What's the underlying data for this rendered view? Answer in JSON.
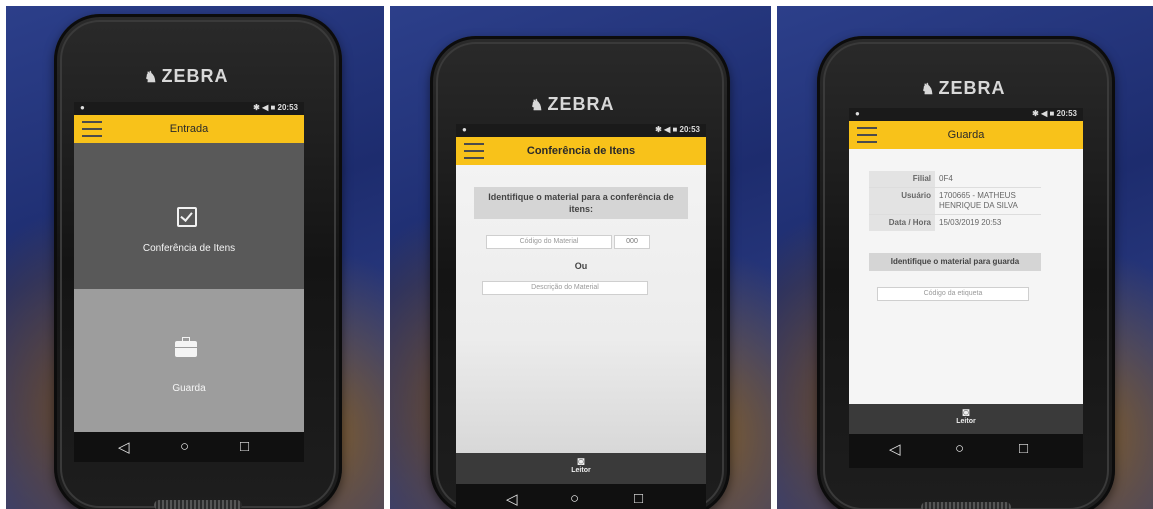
{
  "brand": "ZEBRA",
  "status": {
    "icons": "✱ ◀ ■",
    "time": "20:53"
  },
  "nav": {
    "back": "◁",
    "home": "○",
    "recent": "□"
  },
  "screen1": {
    "title": "Entrada",
    "tile_top": {
      "label": "Conferência de Itens",
      "icon": "checkbox-icon"
    },
    "tile_bottom": {
      "label": "Guarda",
      "icon": "briefcase-icon"
    }
  },
  "screen2": {
    "title": "Conferência de Itens",
    "heading": "Identifique o material para a conferência de itens:",
    "codigo_placeholder": "Código do Material",
    "suffix_value": "000",
    "ou": "Ou",
    "descricao_placeholder": "Descrição do Material",
    "leitor": "Leitor"
  },
  "screen3": {
    "title": "Guarda",
    "info": [
      {
        "label": "Filial",
        "value": "0F4"
      },
      {
        "label": "Usuário",
        "value": "1700665 - MATHEUS HENRIQUE DA SILVA"
      },
      {
        "label": "Data / Hora",
        "value": "15/03/2019 20:53"
      }
    ],
    "heading": "Identifique o material para guarda",
    "etiqueta_placeholder": "Código da etiqueta",
    "leitor": "Leitor"
  },
  "colors": {
    "appbar": "#f8c21a",
    "tile_dark": "#595959",
    "tile_light": "#9d9d9d"
  }
}
